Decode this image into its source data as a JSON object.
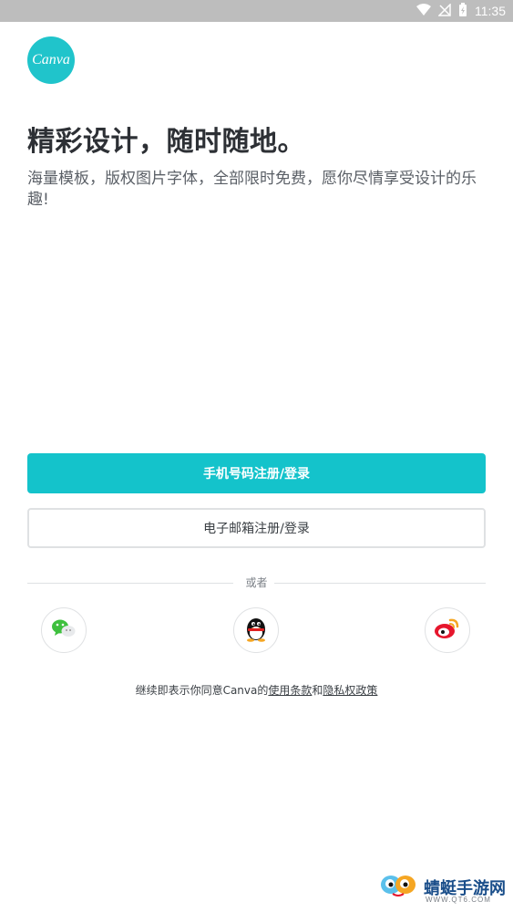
{
  "status_bar": {
    "time": "11:35"
  },
  "logo": {
    "text": "Canva"
  },
  "hero": {
    "title": "精彩设计，随时随地。",
    "subtitle": "海量模板，版权图片字体，全部限时免费，愿你尽情享受设计的乐趣!"
  },
  "buttons": {
    "phone": "手机号码注册/登录",
    "email": "电子邮箱注册/登录"
  },
  "divider": {
    "text": "或者"
  },
  "social": {
    "icons": [
      "wechat-icon",
      "qq-icon",
      "weibo-icon"
    ]
  },
  "terms": {
    "prefix": "继续即表示你同意Canva的",
    "terms_link": "使用条款",
    "and": "和",
    "privacy_link": "隐私权政策"
  },
  "watermark": {
    "title": "蜻蜓手游网",
    "url": "WWW.QT6.COM"
  },
  "colors": {
    "accent": "#14c3cb",
    "logo_bg": "#20c4cb"
  }
}
